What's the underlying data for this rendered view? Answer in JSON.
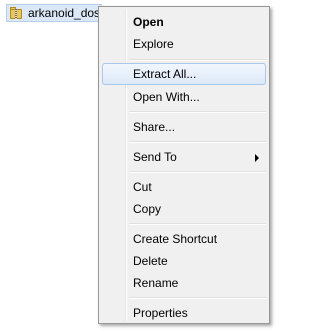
{
  "file": {
    "name": "arkanoid_dos",
    "icon": "zip-folder-icon"
  },
  "menu": {
    "open": "Open",
    "explore": "Explore",
    "extract_all": "Extract All...",
    "open_with": "Open With...",
    "share": "Share...",
    "send_to": "Send To",
    "cut": "Cut",
    "copy": "Copy",
    "create_shortcut": "Create Shortcut",
    "delete": "Delete",
    "rename": "Rename",
    "properties": "Properties",
    "submenu_arrow_icon": "chevron-right-icon"
  },
  "colors": {
    "menu_background": "#f0f0f0",
    "highlight_border": "#a8c8ec",
    "selection_background": "#dbe8f7"
  }
}
